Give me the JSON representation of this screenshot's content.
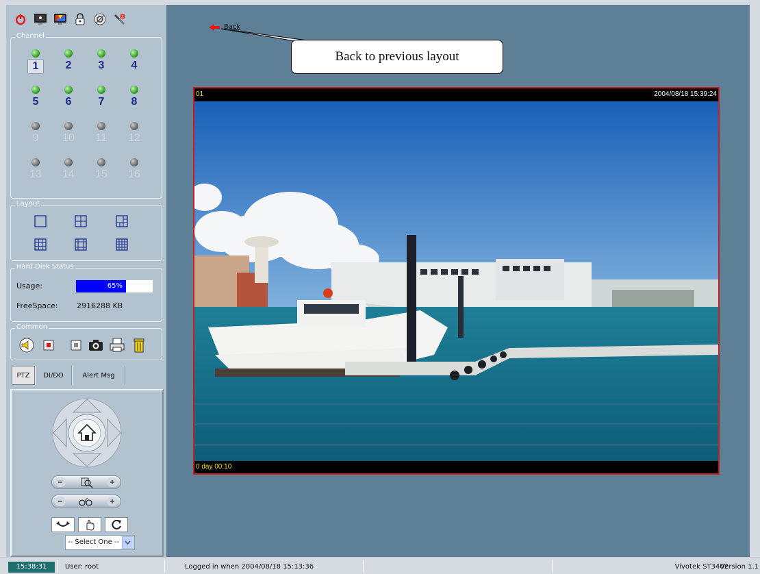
{
  "toolbar": {
    "icons": [
      "power-icon",
      "monitor-icon",
      "color-monitor-icon",
      "lock-icon",
      "settings-icon",
      "tools-icon"
    ]
  },
  "channel": {
    "title": "Channel",
    "channels": [
      {
        "num": "1",
        "active": true,
        "selected": true
      },
      {
        "num": "2",
        "active": true
      },
      {
        "num": "3",
        "active": true
      },
      {
        "num": "4",
        "active": true
      },
      {
        "num": "5",
        "active": true
      },
      {
        "num": "6",
        "active": true
      },
      {
        "num": "7",
        "active": true
      },
      {
        "num": "8",
        "active": true
      },
      {
        "num": "9",
        "active": false
      },
      {
        "num": "10",
        "active": false
      },
      {
        "num": "11",
        "active": false
      },
      {
        "num": "12",
        "active": false
      },
      {
        "num": "13",
        "active": false
      },
      {
        "num": "14",
        "active": false
      },
      {
        "num": "15",
        "active": false
      },
      {
        "num": "16",
        "active": false
      }
    ]
  },
  "layout": {
    "title": "Layout"
  },
  "harddisk": {
    "title": "Hard Disk Status",
    "usage_label": "Usage:",
    "usage_value": "65%",
    "usage_fraction": 0.65,
    "free_label": "FreeSpace:",
    "free_value": "2916288 KB"
  },
  "common": {
    "title": "Common",
    "icons": [
      "speaker-icon",
      "record-icon",
      "stop-icon",
      "camera-icon",
      "print-icon",
      "trash-icon"
    ]
  },
  "tabs": [
    {
      "label": "PTZ"
    },
    {
      "label": "DI/DO"
    },
    {
      "label": "Alert Msg"
    }
  ],
  "ptz": {
    "select_value": "-- Select One --"
  },
  "main": {
    "back_label": "Back",
    "callout": "Back to previous layout"
  },
  "video": {
    "channel": "01",
    "timestamp": "2004/08/18 15:39:24",
    "uptime": "0 day  00:10"
  },
  "status": {
    "clock": "15:38:31",
    "user": "User: root",
    "login": "Logged in when  2004/08/18 15:13:36",
    "product": "Vivotek ST3402",
    "version": "Version 1.1"
  },
  "colors": {
    "panel": "#b2c2cf",
    "main_bg": "#5d8097",
    "border_red": "#cc1d1d",
    "usage_bar": "#0000ff",
    "clock_bg": "#1f6e6e"
  }
}
